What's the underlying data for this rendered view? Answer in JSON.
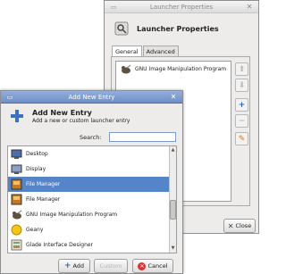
{
  "launcher_window": {
    "title": "Launcher Properties",
    "heading": "Launcher Properties",
    "tabs": [
      "General",
      "Advanced"
    ],
    "items": [
      "GNU Image Manipulation Program"
    ],
    "close_label": "Close"
  },
  "add_window": {
    "title": "Add New Entry",
    "heading": "Add New Entry",
    "subheading": "Add a new or custom launcher entry",
    "search_label": "Search:",
    "search_value": "",
    "entries": [
      "Desktop",
      "Display",
      "File Manager",
      "File Manager",
      "GNU Image Manipulation Program",
      "Geany",
      "Glade Interface Designer"
    ],
    "add_label": "Add",
    "custom_label": "Custom",
    "cancel_label": "Cancel"
  },
  "colors": {
    "selection": "#5585c8",
    "title_active": "#7e9bd0"
  }
}
